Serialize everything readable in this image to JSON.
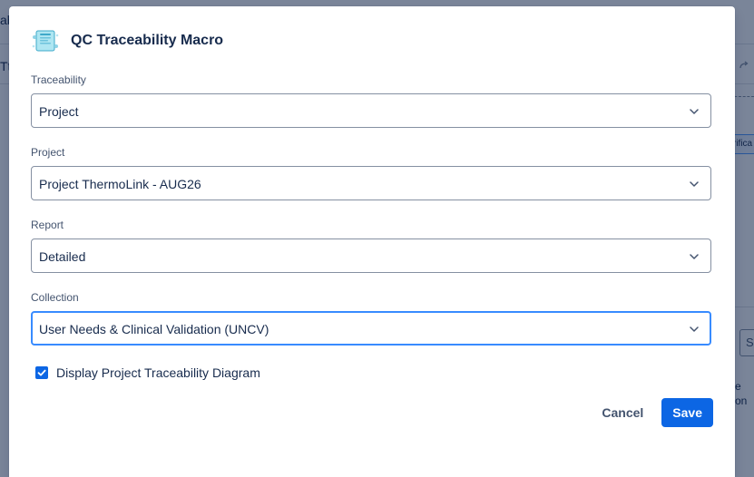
{
  "background": {
    "left_text": "ab",
    "left_text2": "Tt",
    "chip_text": "rifica",
    "box_text": "S",
    "side_text1": "e",
    "side_text2": "on",
    "undo_icon": "redo-icon"
  },
  "modal": {
    "title": "QC Traceability Macro",
    "icon": "document-app-icon",
    "fields": [
      {
        "label": "Traceability",
        "value": "Project"
      },
      {
        "label": "Project",
        "value": "Project ThermoLink - AUG26"
      },
      {
        "label": "Report",
        "value": "Detailed"
      },
      {
        "label": "Collection",
        "value": "User Needs & Clinical Validation (UNCV)"
      }
    ],
    "checkbox": {
      "label": "Display Project Traceability Diagram",
      "checked": true
    },
    "cancel_label": "Cancel",
    "save_label": "Save"
  },
  "colors": {
    "primary": "#0c66e4",
    "focus_border": "#388bff",
    "text": "#172b4d",
    "subtle_text": "#44546f",
    "overlay": "rgba(9, 30, 66, 0.54)"
  }
}
